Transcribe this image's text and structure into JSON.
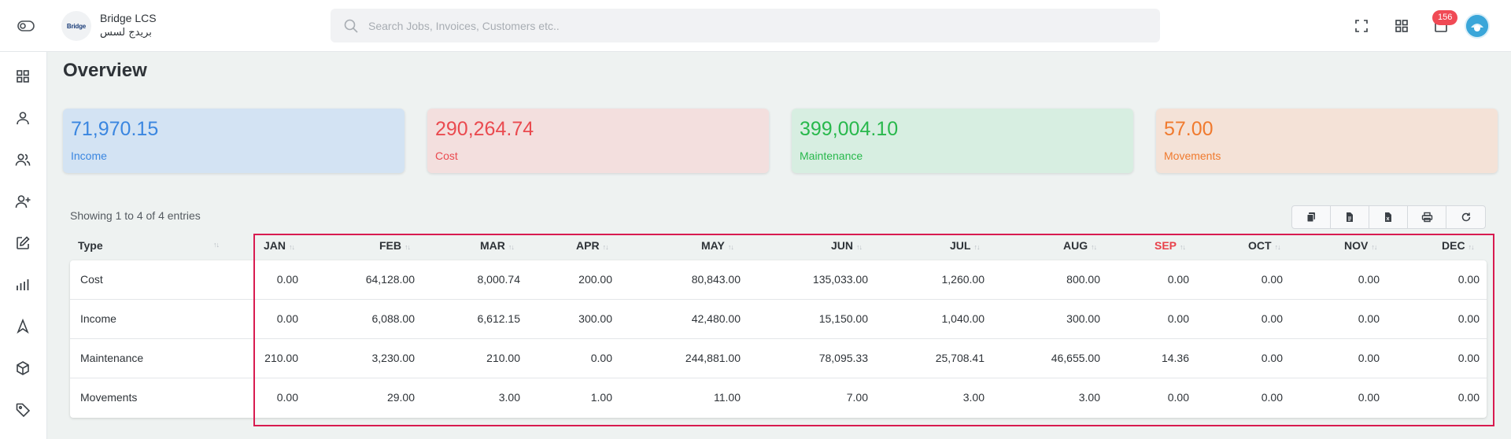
{
  "header": {
    "company_name": "Bridge LCS",
    "company_name_ar": "بريدج لسس",
    "logo_text": "Bridge",
    "search_placeholder": "Search Jobs, Invoices, Customers etc..",
    "notification_count": "156"
  },
  "page": {
    "title": "Overview"
  },
  "cards": [
    {
      "value": "71,970.15",
      "label": "Income",
      "text_color": "#3a86e0",
      "bg": "#d3e3f3"
    },
    {
      "value": "290,264.74",
      "label": "Cost",
      "text_color": "#ea4a4f",
      "bg": "#f3dfde"
    },
    {
      "value": "399,004.10",
      "label": "Maintenance",
      "text_color": "#28b84c",
      "bg": "#d7eee1"
    },
    {
      "value": "57.00",
      "label": "Movements",
      "text_color": "#f07a2e",
      "bg": "#f4e2d7"
    }
  ],
  "table": {
    "info": "Showing 1 to 4 of 4 entries",
    "columns": [
      "Type",
      "JAN",
      "FEB",
      "MAR",
      "APR",
      "MAY",
      "JUN",
      "JUL",
      "AUG",
      "SEP",
      "OCT",
      "NOV",
      "DEC"
    ],
    "rows": [
      [
        "Cost",
        "0.00",
        "64,128.00",
        "8,000.74",
        "200.00",
        "80,843.00",
        "135,033.00",
        "1,260.00",
        "800.00",
        "0.00",
        "0.00",
        "0.00",
        "0.00"
      ],
      [
        "Income",
        "0.00",
        "6,088.00",
        "6,612.15",
        "300.00",
        "42,480.00",
        "15,150.00",
        "1,040.00",
        "300.00",
        "0.00",
        "0.00",
        "0.00",
        "0.00"
      ],
      [
        "Maintenance",
        "210.00",
        "3,230.00",
        "210.00",
        "0.00",
        "244,881.00",
        "78,095.33",
        "25,708.41",
        "46,655.00",
        "14.36",
        "0.00",
        "0.00",
        "0.00"
      ],
      [
        "Movements",
        "0.00",
        "29.00",
        "3.00",
        "1.00",
        "11.00",
        "7.00",
        "3.00",
        "3.00",
        "0.00",
        "0.00",
        "0.00",
        "0.00"
      ]
    ],
    "highlighted_column_color": "#e8414a",
    "highlight_border_color": "#d81b50"
  }
}
